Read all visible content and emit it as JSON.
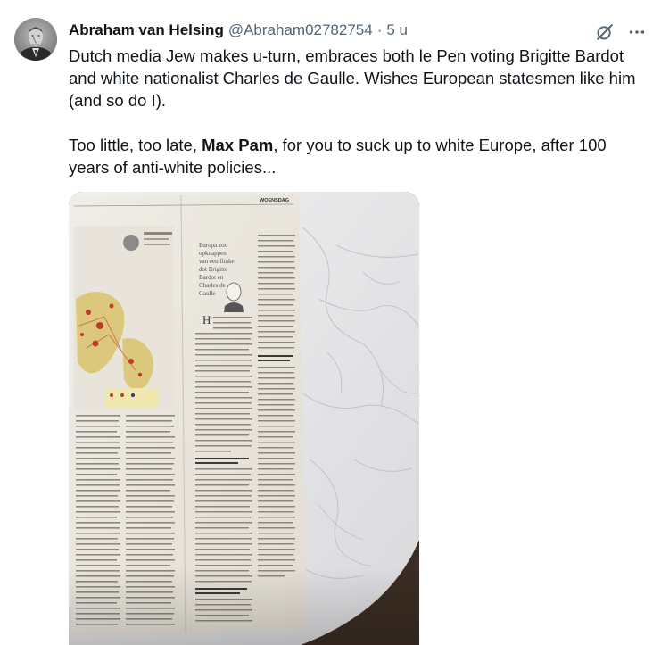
{
  "tweet": {
    "author": {
      "display_name": "Abraham van Helsing",
      "handle": "@Abraham02782754",
      "separator": "·",
      "time": "5 u"
    },
    "text": {
      "para1": "Dutch media Jew makes u-turn, embraces both le Pen voting Brigitte Bardot and white nationalist Charles de Gaulle. Wishes European statesmen like him (and so do I).",
      "para2_before": "Too little, too late, ",
      "para2_mention": "Max Pam",
      "para2_after": ", for you to suck up to white Europe, after 100 years of anti-white policies..."
    },
    "media": {
      "newspaper_header": "WOENSDAG",
      "headline": "Europa zoo opknappen van een flinke dot Brigitte Bardot en Charles de Gaulle",
      "subhead_1": "Plotseling moest ik denken aan",
      "subhead_2": "Maar ze was beslist niet te voor iedereen",
      "subhead_3": "Mijn vader"
    },
    "icons": {
      "grok": "grok-icon",
      "more": "more-dots-icon"
    },
    "colors": {
      "text_primary": "#0f1419",
      "text_secondary": "#536471",
      "marble": "#e9e9ea",
      "paper": "#ebe7df"
    }
  }
}
